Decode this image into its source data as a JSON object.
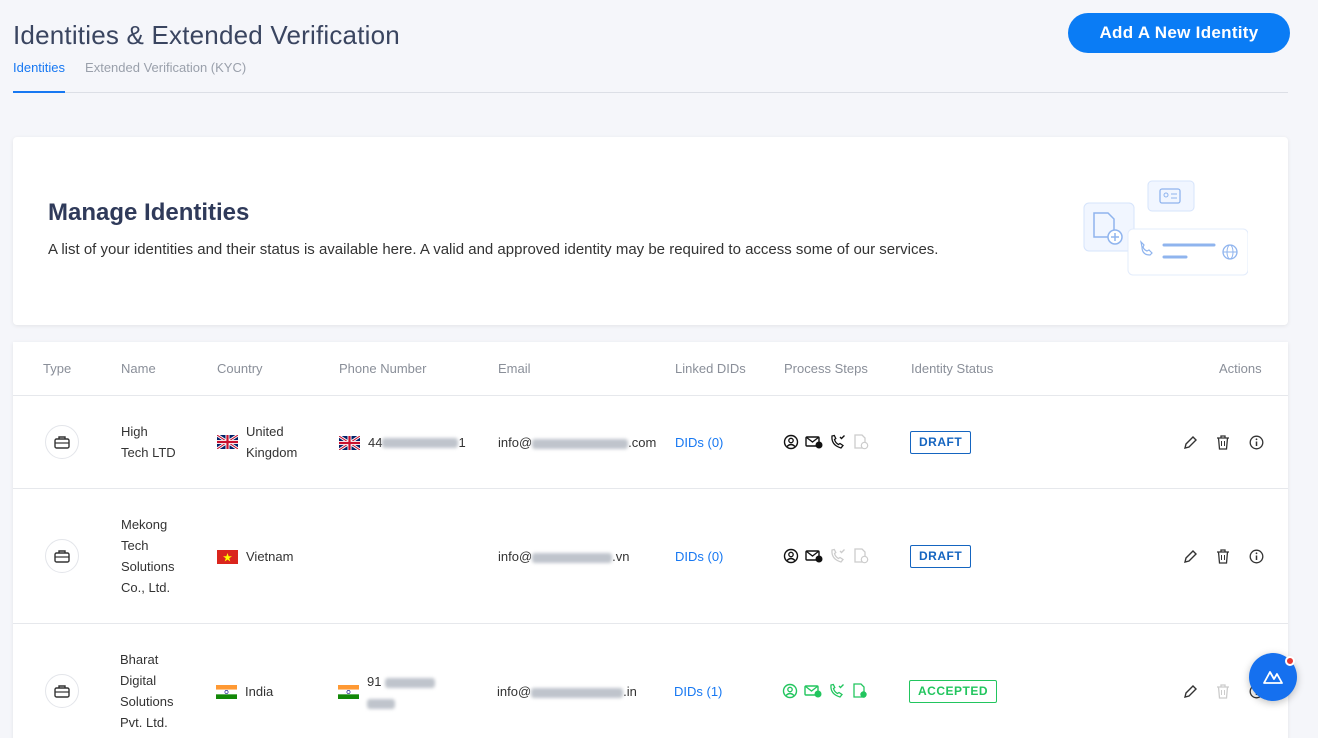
{
  "header": {
    "title": "Identities & Extended Verification",
    "add_button": "Add A New Identity",
    "tabs": [
      {
        "label": "Identities",
        "active": true
      },
      {
        "label": "Extended Verification (KYC)",
        "active": false
      }
    ]
  },
  "intro": {
    "title": "Manage Identities",
    "description": "A list of your identities and their status is available here. A valid and approved identity may be required to access some of our services."
  },
  "table": {
    "columns": [
      "Type",
      "Name",
      "Country",
      "Phone Number",
      "Email",
      "Linked DIDs",
      "Process Steps",
      "Identity Status",
      "Actions"
    ],
    "rows": [
      {
        "type_icon": "briefcase-icon",
        "name_lines": [
          "High",
          "Tech LTD"
        ],
        "flag": "uk-flag",
        "country_lines": [
          "United",
          "Kingdom"
        ],
        "phone_visible": "44",
        "phone_end": "1",
        "email_prefix": "info@",
        "email_suffix": ".com",
        "linked_dids": "DIDs (0)",
        "status": "DRAFT"
      },
      {
        "type_icon": "briefcase-icon",
        "name_lines": [
          "Mekong",
          "Tech",
          "Solutions",
          "Co., Ltd."
        ],
        "flag": "vietnam-flag",
        "country_lines": [
          "Vietnam"
        ],
        "phone_visible": "",
        "email_prefix": "info@",
        "email_suffix": ".vn",
        "linked_dids": "DIDs (0)",
        "status": "DRAFT"
      },
      {
        "type_icon": "briefcase-icon",
        "name_lines": [
          "Bharat",
          "Digital",
          "Solutions",
          "Pvt. Ltd."
        ],
        "flag": "india-flag",
        "country_lines": [
          "India"
        ],
        "phone_visible": "91",
        "email_prefix": "info@",
        "email_suffix": ".in",
        "linked_dids": "DIDs (1)",
        "status": "ACCEPTED"
      }
    ]
  },
  "colors": {
    "accent": "#0a7cf5",
    "draft": "#1565c0",
    "accepted": "#22c55e",
    "title": "#3a4560"
  }
}
